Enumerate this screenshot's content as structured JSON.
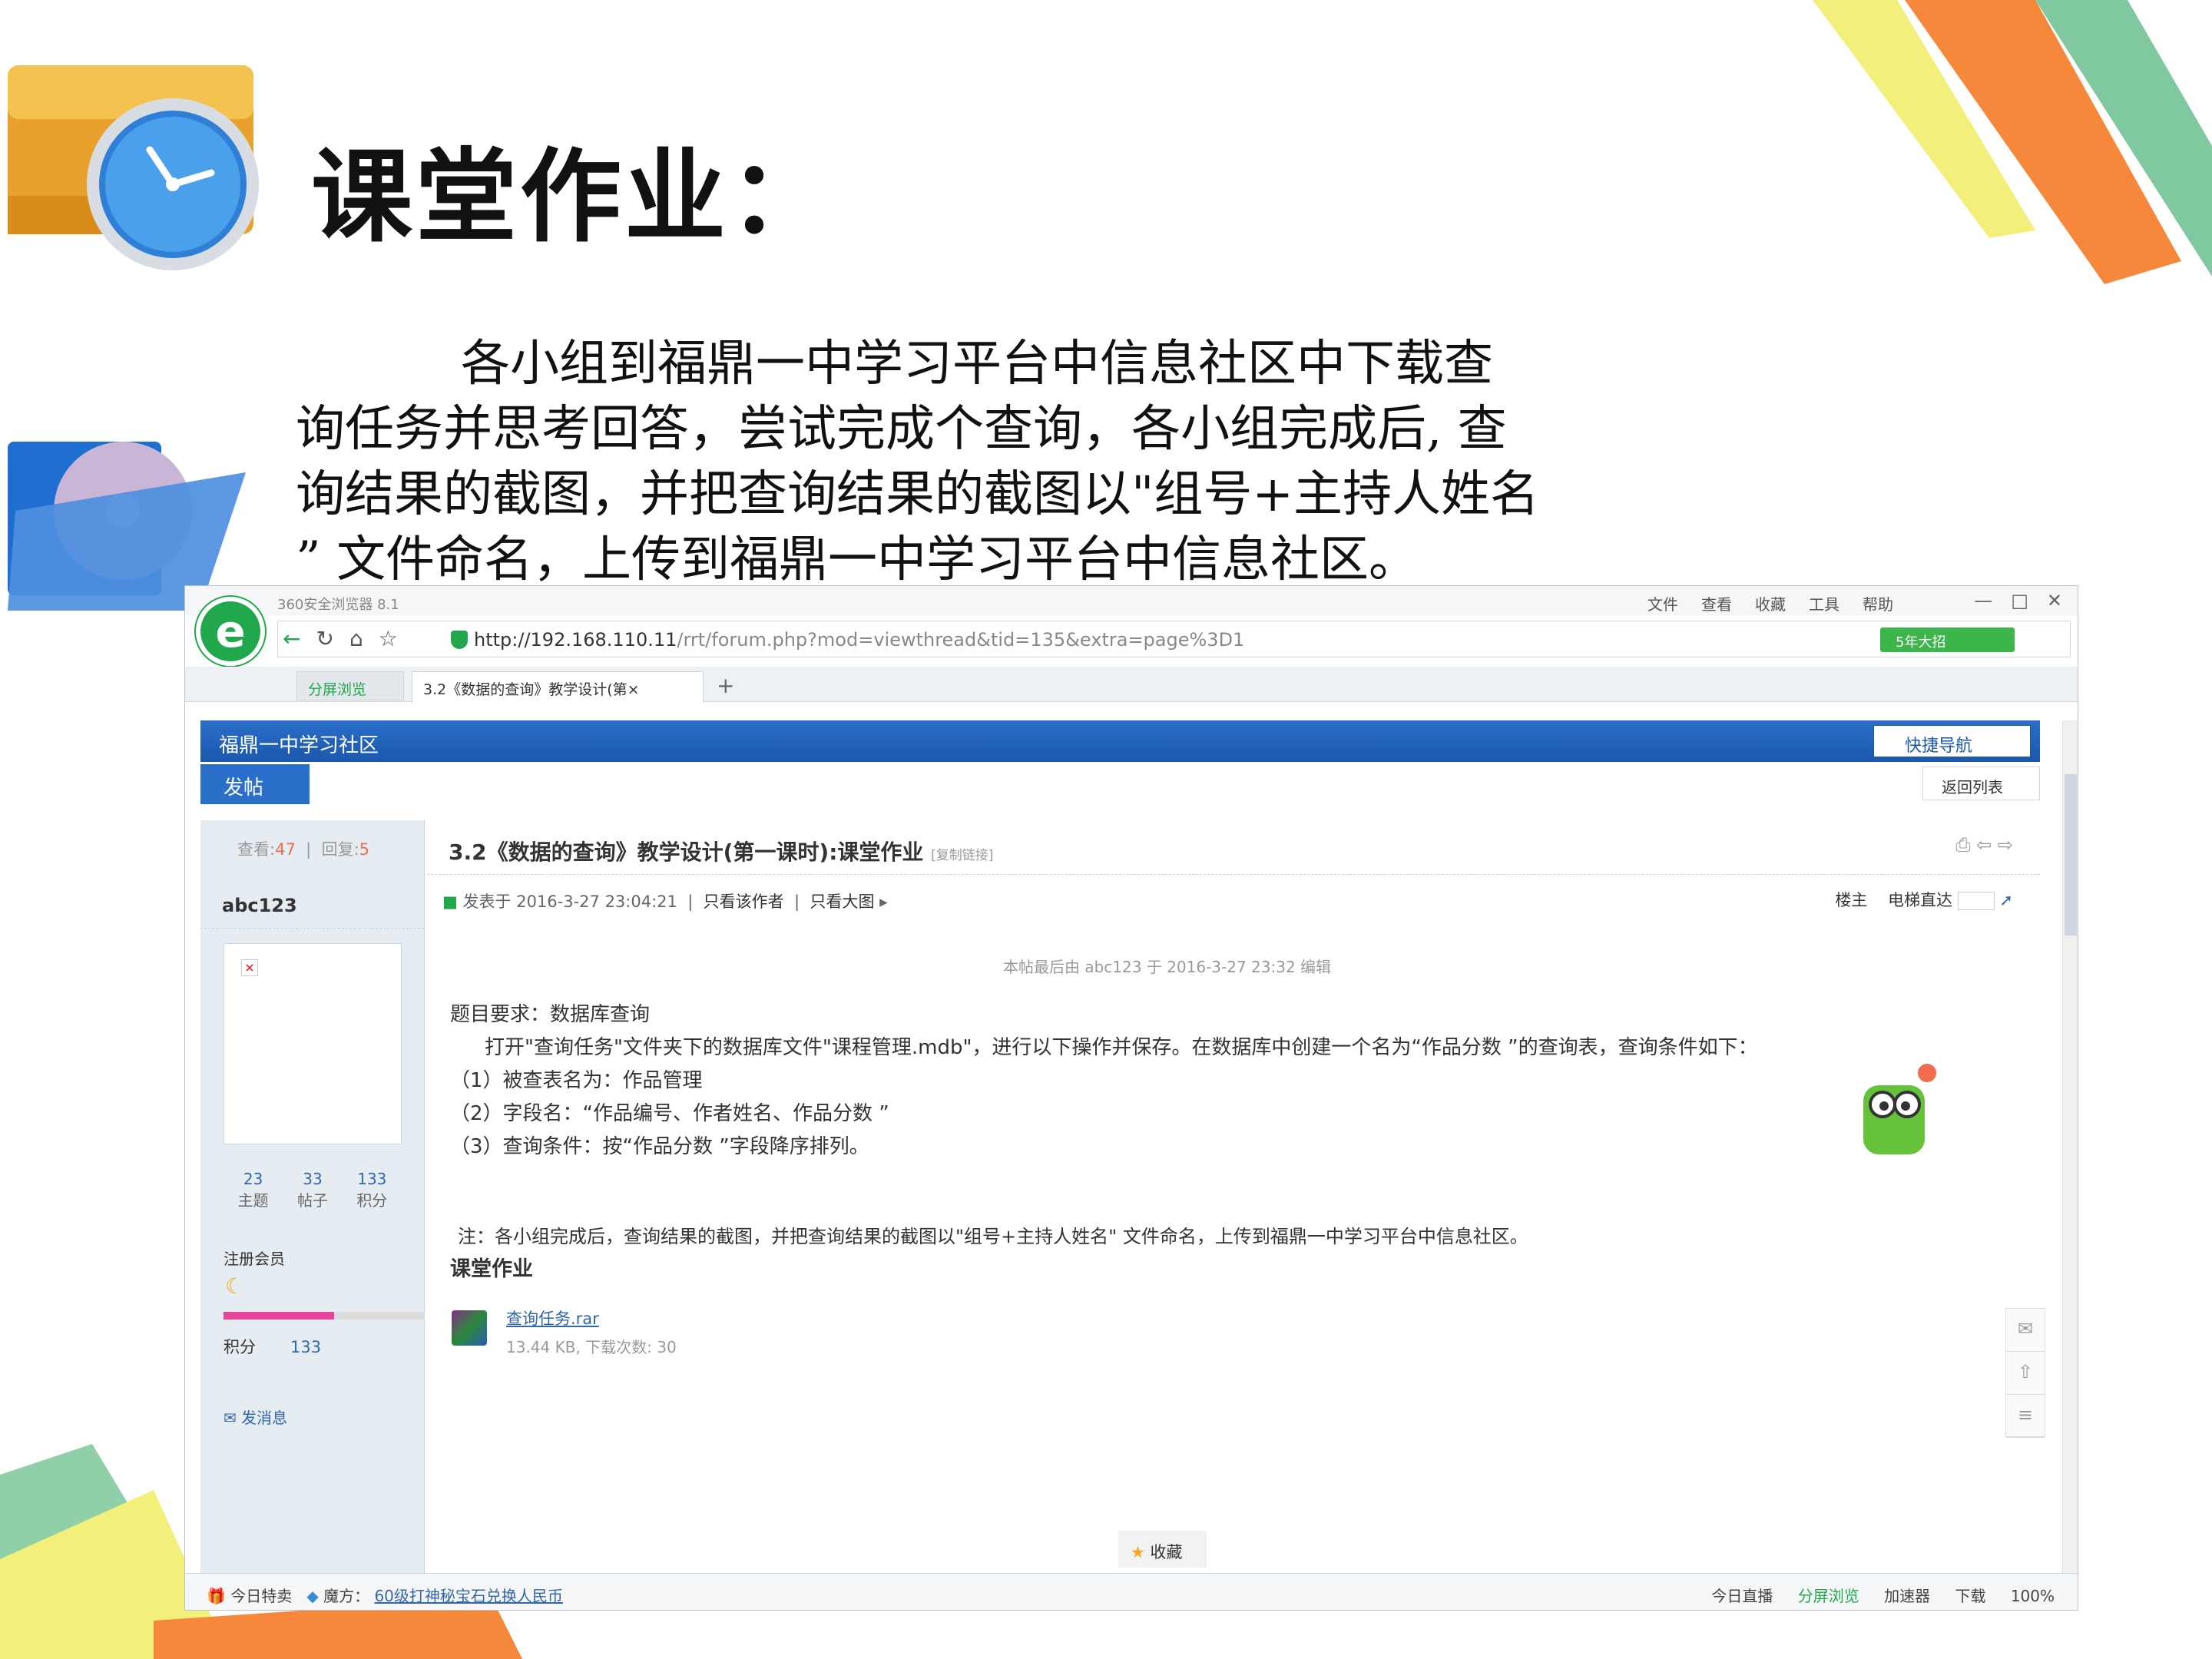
{
  "slide": {
    "title": "课堂作业：",
    "body_lines": [
      "各小组到福鼎一中学习平台中信息社区中下载查",
      "询任务并思考回答，尝试完成个查询，各小组完成后, 查",
      "询结果的截图，并把查询结果的截图以\"组号+主持人姓名",
      "” 文件命名，上传到福鼎一中学习平台中信息社区。"
    ]
  },
  "browser": {
    "app_name": "360安全浏览器 8.1",
    "menu": [
      "文件",
      "查看",
      "收藏",
      "工具",
      "帮助"
    ],
    "url_host": "http://192.168.110.11",
    "url_path": "/rrt/forum.php?mod=viewthread&tid=135&extra=page%3D1",
    "speed_label": "5年大招",
    "tab_split_label": "分屏浏览",
    "tab_title": "3.2《数据的查询》教学设计(第×",
    "window_controls": [
      "—",
      "□",
      "✕"
    ]
  },
  "forum": {
    "name": "福鼎一中学习社区",
    "quicknav_label": "快捷导航",
    "post_button": "发帖",
    "back_button": "返回列表",
    "views_label": "查看:",
    "views": "47",
    "replies_label": "回复:",
    "replies": "5",
    "username": "abc123",
    "counters": [
      {
        "value": "23",
        "label": "主题"
      },
      {
        "value": "33",
        "label": "帖子"
      },
      {
        "value": "133",
        "label": "积分"
      }
    ],
    "member_label": "注册会员",
    "points_label": "积分",
    "points": "133",
    "level_progress": 0.55,
    "message_link": "发消息",
    "thread_title": "3.2《数据的查询》教学设计(第一课时):课堂作业",
    "copy_link": "[复制链接]",
    "posted_at": "发表于 2016-3-27 23:04:21",
    "only_author": "只看该作者",
    "only_big_img": "只看大图",
    "floor_owner": "楼主",
    "elevator": "电梯直达",
    "edit_note": "本帖最后由 abc123 于 2016-3-27 23:32 编辑",
    "post_lines": [
      "题目要求：数据库查询",
      "打开\"查询任务\"文件夹下的数据库文件\"课程管理.mdb\"，进行以下操作并保存。在数据库中创建一个名为“作品分数 ”的查询表，查询条件如下：",
      "（1）被查表名为：作品管理",
      "（2）字段名：“作品编号、作者姓名、作品分数 ”",
      "（3）查询条件：按“作品分数 ”字段降序排列。"
    ],
    "note": "注：各小组完成后，查询结果的截图，并把查询结果的截图以\"组号+主持人姓名\" 文件命名，上传到福鼎一中学习平台中信息社区。",
    "section_title": "课堂作业",
    "attachment_name": "查询任务.rar",
    "attachment_info": "13.44 KB, 下载次数: 30",
    "favorite": "收藏"
  },
  "statusbar": {
    "today_sale": "今日特卖",
    "magic": "魔方：",
    "promo_link": "60级打神秘宝石兑换人民币",
    "items": [
      "今日直播",
      "分屏浏览",
      "加速器",
      "下载"
    ],
    "zoom": "100%"
  }
}
